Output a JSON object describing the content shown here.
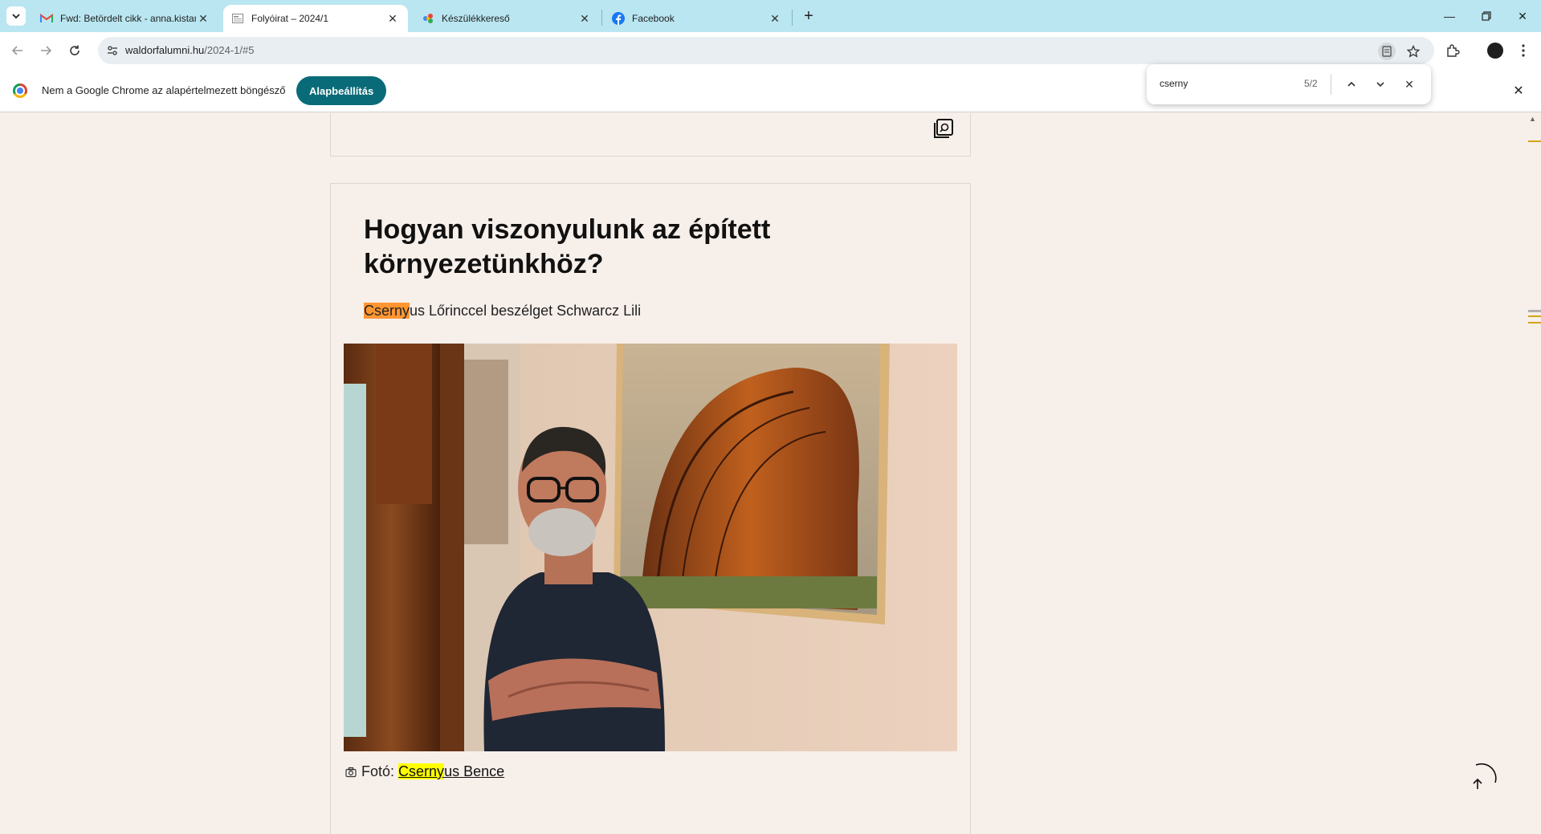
{
  "tabs": [
    {
      "title": "Fwd: Betördelt cikk - anna.kistamas@",
      "icon": "gmail-icon",
      "active": false
    },
    {
      "title": "Folyóirat – 2024/1",
      "icon": "page-icon",
      "active": true
    },
    {
      "title": "Készülékkereső",
      "icon": "device-finder-icon",
      "active": false
    },
    {
      "title": "Facebook",
      "icon": "facebook-icon",
      "active": false
    }
  ],
  "toolbar": {
    "url_host": "waldorfalumni.hu",
    "url_path": "/2024-1/#5"
  },
  "infobar": {
    "message": "Nem a Google Chrome az alapértelmezett böngésző",
    "button_label": "Alapbeállítás"
  },
  "findbar": {
    "query": "cserny",
    "count": "5/2"
  },
  "article": {
    "title": "Hogyan viszonyulunk az épített környezetünkhöz?",
    "subtitle_match": "Cserny",
    "subtitle_rest": "us Lőrinccel beszélget Schwarcz Lili",
    "caption_prefix": "Fotó: ",
    "caption_match": "Cserny",
    "caption_rest": "us Bence"
  },
  "colors": {
    "tabstrip": "#b9e6f1",
    "page_bg": "#f7efea",
    "accent_button": "#0a6b78",
    "find_current": "#ff9632",
    "find_match": "#ffff00"
  }
}
